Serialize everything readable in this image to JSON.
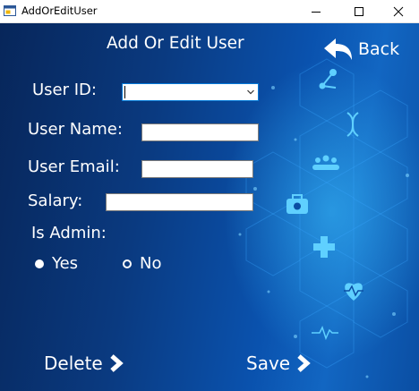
{
  "window": {
    "title": "AddOrEditUser",
    "controls": {
      "minimize": "minimize-icon",
      "maximize": "maximize-icon",
      "close": "close-icon"
    }
  },
  "form": {
    "heading": "Add Or Edit User",
    "back_label": "Back",
    "fields": {
      "user_id_label": "User ID:",
      "user_id_value": "",
      "user_name_label": "User Name:",
      "user_name_value": "",
      "user_email_label": "User Email:",
      "user_email_value": "",
      "salary_label": "Salary:",
      "salary_value": "",
      "is_admin_label": "Is Admin:"
    },
    "is_admin_options": [
      {
        "label": "Yes",
        "checked": true
      },
      {
        "label": "No",
        "checked": false
      }
    ],
    "actions": {
      "delete_label": "Delete",
      "save_label": "Save"
    }
  },
  "theme": {
    "background_dark": "#07265a",
    "background_light": "#1266c2",
    "accent_glow": "#2fb6ff",
    "text": "#ffffff"
  },
  "icons": {
    "background": [
      "molecule-icon",
      "dna-icon",
      "people-icon",
      "medical-kit-icon",
      "medical-cross-icon",
      "heartbeat-icon",
      "pulse-line-icon"
    ],
    "back": "back-arrow-icon",
    "actions": "chevron-right-icon"
  }
}
